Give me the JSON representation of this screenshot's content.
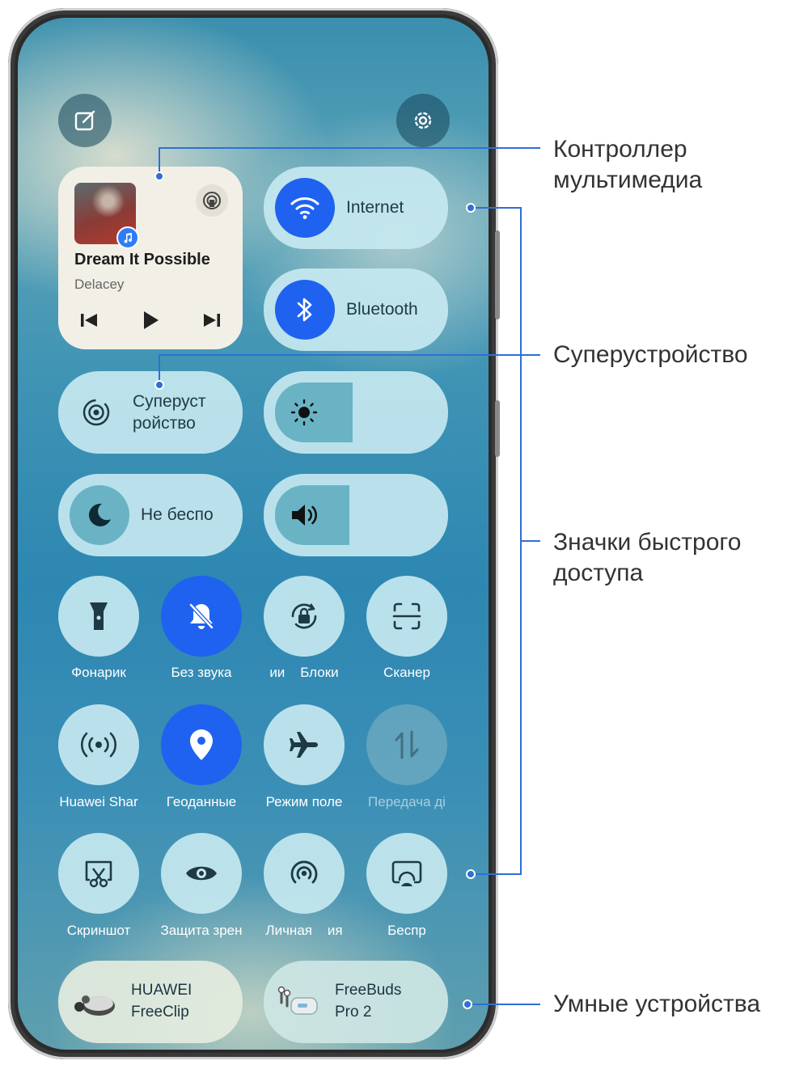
{
  "header": {
    "edit_icon": "edit-icon",
    "settings_icon": "gear-icon"
  },
  "media": {
    "title": "Dream It Possible",
    "artist": "Delacey",
    "icons": [
      "previous-icon",
      "play-icon",
      "next-icon",
      "cast-icon",
      "music-app-icon"
    ]
  },
  "toggles": {
    "internet": "Internet",
    "bluetooth": "Bluetooth"
  },
  "superdevice": {
    "label_line1": "Суперуст",
    "label_line2": "ройство"
  },
  "dnd": {
    "label": "Не беспо"
  },
  "tiles": [
    {
      "label": "Фонарик",
      "icon": "flashlight-icon",
      "state": "off"
    },
    {
      "label": "Без звука",
      "icon": "bell-off-icon",
      "state": "on"
    },
    {
      "label": "ии    Блоки",
      "icon": "rotation-lock-icon",
      "state": "off"
    },
    {
      "label": "Сканер",
      "icon": "scanner-icon",
      "state": "off"
    },
    {
      "label": "Huawei Shar",
      "icon": "huawei-share-icon",
      "state": "off"
    },
    {
      "label": "Геоданные",
      "icon": "location-icon",
      "state": "on"
    },
    {
      "label": "Режим поле",
      "icon": "airplane-icon",
      "state": "off"
    },
    {
      "label": "Передача ді",
      "icon": "mobile-data-icon",
      "state": "disabled"
    },
    {
      "label": "Скриншот",
      "icon": "screenshot-icon",
      "state": "off"
    },
    {
      "label": "Защита зрен",
      "icon": "eye-icon",
      "state": "off"
    },
    {
      "label": "Личная    ия",
      "icon": "hotspot-icon",
      "state": "off"
    },
    {
      "label": "Беспр",
      "icon": "wireless-projection-icon",
      "state": "off"
    }
  ],
  "devices": [
    {
      "line1": "HUAWEI",
      "line2": "FreeClip"
    },
    {
      "line1": "FreeBuds",
      "line2": "Pro 2"
    }
  ],
  "annotations": {
    "media_controller_line1": "Контроллер",
    "media_controller_line2": "мультимедиа",
    "superdevice": "Суперустройство",
    "shortcuts_line1": "Значки быстрого",
    "shortcuts_line2": "доступа",
    "smart_devices": "Умные устройства"
  },
  "colors": {
    "accent": "#1f62f0",
    "annotation": "#2f6fd6"
  }
}
